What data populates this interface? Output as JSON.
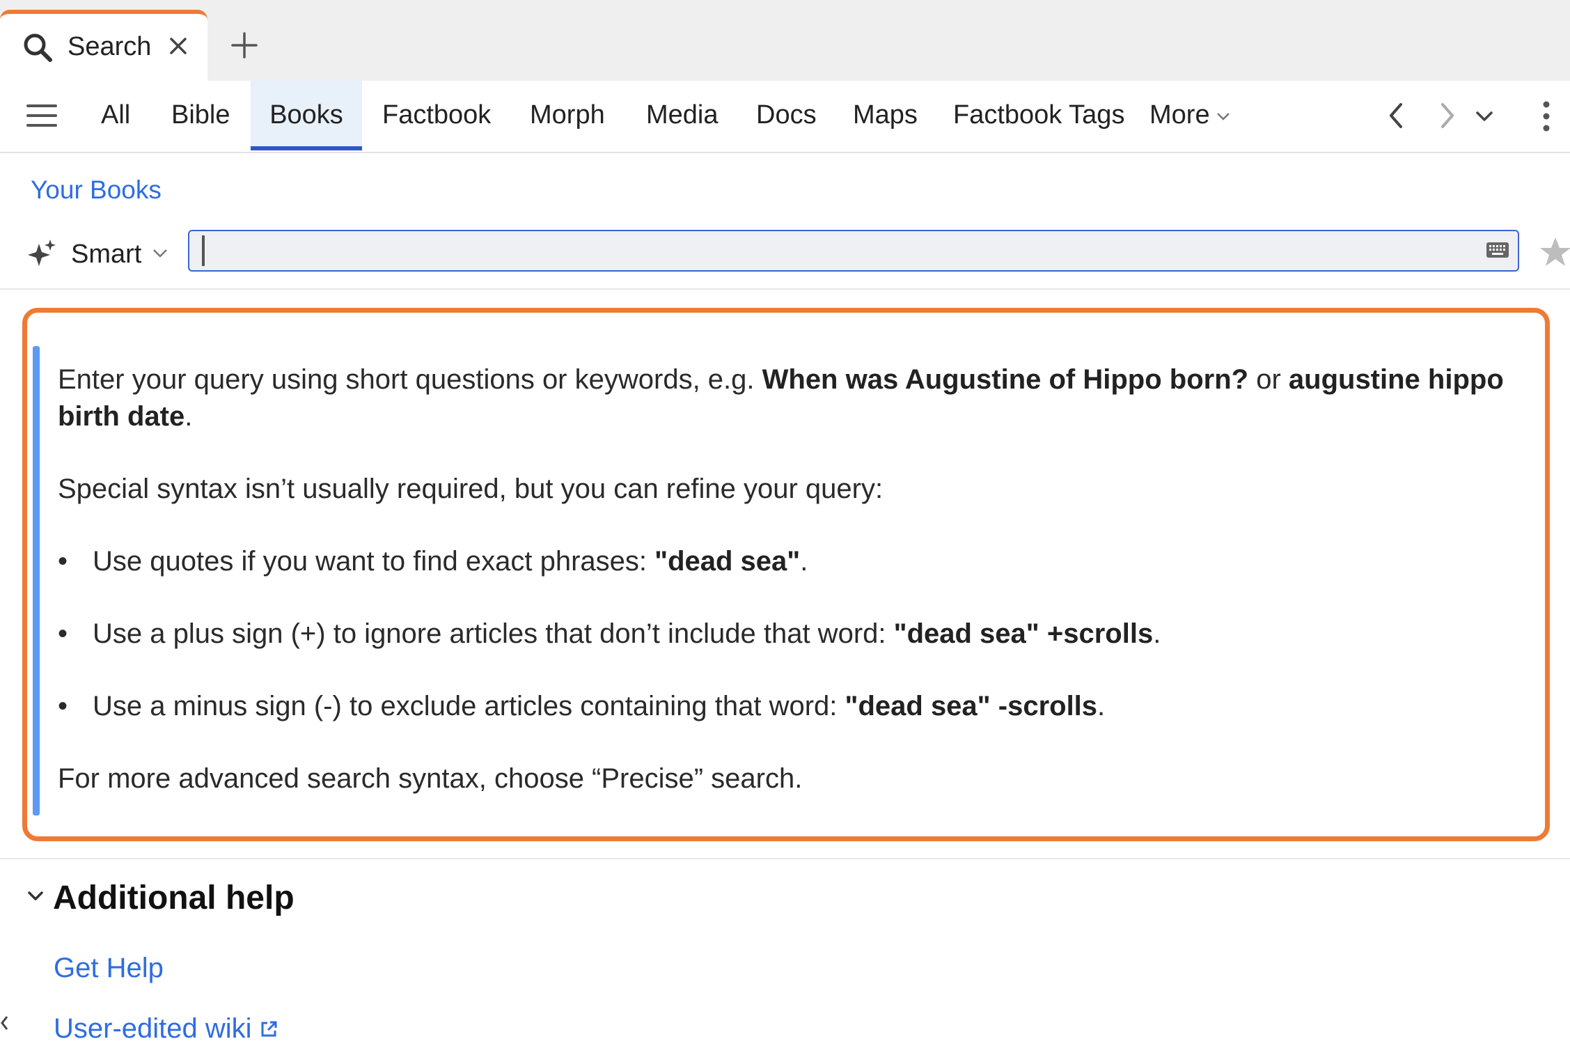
{
  "tab": {
    "label": "Search"
  },
  "nav": {
    "items": [
      "All",
      "Bible",
      "Books",
      "Factbook",
      "Morph",
      "Media",
      "Docs",
      "Maps",
      "Factbook Tags"
    ],
    "active": "Books",
    "more_label": "More"
  },
  "breadcrumb": {
    "label": "Your Books"
  },
  "search": {
    "mode_label": "Smart",
    "value": "",
    "placeholder": ""
  },
  "help": {
    "intro_pre": "Enter your query using short questions or keywords, e.g. ",
    "intro_example1": "When was Augustine of Hippo born?",
    "intro_or": " or ",
    "intro_example2": "augustine hippo birth date",
    "intro_end": ".",
    "syntax_note": "Special syntax isn’t usually required, but you can refine your query:",
    "bullets": [
      {
        "text": "Use quotes if you want to find exact phrases: ",
        "example": "\"dead sea\"",
        "end": "."
      },
      {
        "text": "Use a plus sign (+) to ignore articles that don’t include that word: ",
        "example": "\"dead sea\" +scrolls",
        "end": "."
      },
      {
        "text": "Use a minus sign (-) to exclude articles containing that word: ",
        "example": "\"dead sea\" -scrolls",
        "end": "."
      }
    ],
    "footer": "For more advanced search syntax, choose “Precise” search."
  },
  "additional_help": {
    "title": "Additional help",
    "links": [
      "Get Help",
      "User-edited wiki"
    ]
  },
  "colors": {
    "accent_orange": "#ee7a34",
    "link_blue": "#2e6de0",
    "active_tab_underline": "#2f55c9",
    "help_accent_bar": "#5b9af5"
  },
  "icons": [
    "search-icon",
    "close-icon",
    "plus-icon",
    "hamburger-icon",
    "chevron-down-icon",
    "chevron-left-icon",
    "chevron-right-icon",
    "kebab-icon",
    "sparkle-icon",
    "keyboard-icon",
    "star-icon",
    "external-link-icon"
  ]
}
